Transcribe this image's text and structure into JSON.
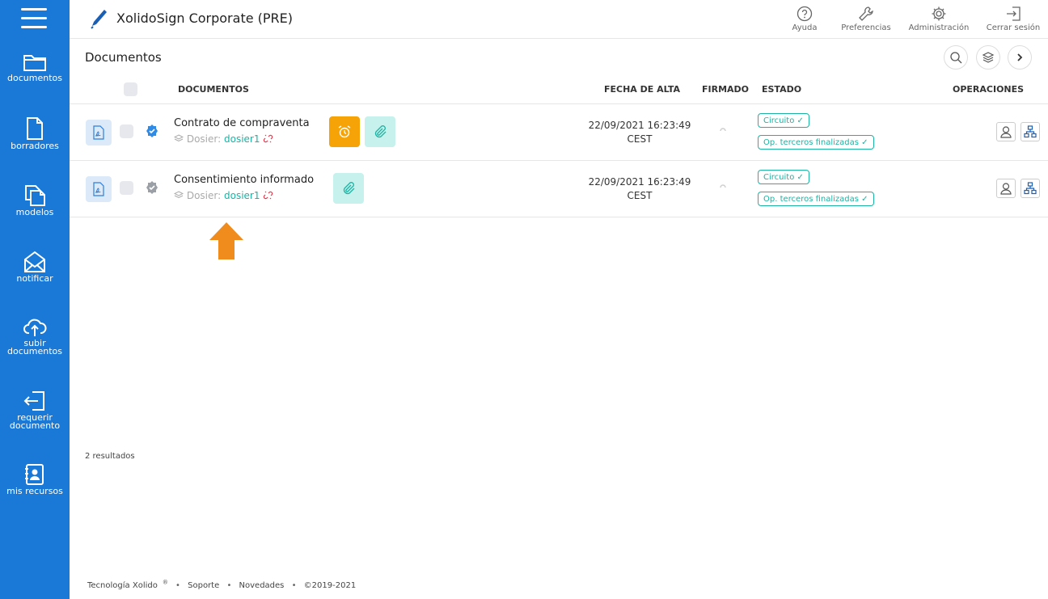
{
  "app": {
    "title": "XolidoSign Corporate (PRE)"
  },
  "sidebar": {
    "items": [
      {
        "label": "documentos",
        "icon": "folder-icon"
      },
      {
        "label": "borradores",
        "icon": "file-icon"
      },
      {
        "label": "modelos",
        "icon": "copy-icon"
      },
      {
        "label": "notificar",
        "icon": "envelope-icon"
      },
      {
        "label_line1": "subir",
        "label_line2": "documentos",
        "icon": "cloud-upload-icon"
      },
      {
        "label_line1": "requerir",
        "label_line2": "documento",
        "icon": "login-icon"
      },
      {
        "label": "mis recursos",
        "icon": "contact-book-icon"
      }
    ]
  },
  "header": {
    "actions": [
      {
        "label": "Ayuda",
        "icon": "help-icon"
      },
      {
        "label": "Preferencias",
        "icon": "wrench-icon"
      },
      {
        "label": "Administración",
        "icon": "gear-icon"
      },
      {
        "label": "Cerrar sesión",
        "icon": "logout-icon"
      }
    ]
  },
  "main": {
    "title": "Documentos",
    "columns": {
      "documentos": "DOCUMENTOS",
      "fecha": "FECHA DE ALTA",
      "firmado": "FIRMADO",
      "estado": "ESTADO",
      "operaciones": "OPERACIONES"
    },
    "rows": [
      {
        "name": "Contrato de compraventa",
        "dosier_label": "Dosier:",
        "dosier_link": "dosier1",
        "date": "22/09/2021 16:23:49",
        "tz": "CEST",
        "badges": [
          "Circuito",
          "Op. terceros finalizadas"
        ],
        "verified_color": "#2f8be6"
      },
      {
        "name": "Consentimiento informado",
        "dosier_label": "Dosier:",
        "dosier_link": "dosier1",
        "date": "22/09/2021 16:23:49",
        "tz": "CEST",
        "badges": [
          "Circuito",
          "Op. terceros finalizadas"
        ],
        "verified_color": "#9aa0a6"
      }
    ],
    "results": "2 resultados"
  },
  "footer": {
    "brand": "Tecnología Xolido",
    "reg": "®",
    "soporte": "Soporte",
    "novedades": "Novedades",
    "copyright": "©2019-2021"
  },
  "colors": {
    "sidebar": "#1a78d6",
    "accent_teal": "#1bb3a4",
    "alarm_orange": "#f5a306",
    "annotation_arrow": "#f08c1e"
  }
}
